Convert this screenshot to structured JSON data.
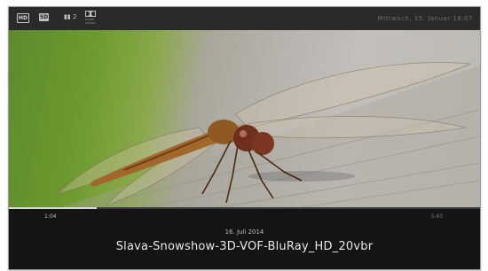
{
  "status_bar": {
    "hd_badge": "HD",
    "sd_badge": "SD",
    "audio_channels": "2",
    "dolby_text": "DOLBY DIGITAL",
    "datetime": "Mittwoch, 15. Januar   18:07"
  },
  "playback": {
    "elapsed": "1:04",
    "duration": "5:43",
    "progress_fraction": 0.187
  },
  "recording": {
    "date": "16. Juli 2014",
    "title": "Slava-Snowshow-3D-VOF-BluRay_HD_20vbr"
  },
  "icons": [
    "hd-icon",
    "sd-icon",
    "audio-channels-icon",
    "dolby-icon"
  ]
}
